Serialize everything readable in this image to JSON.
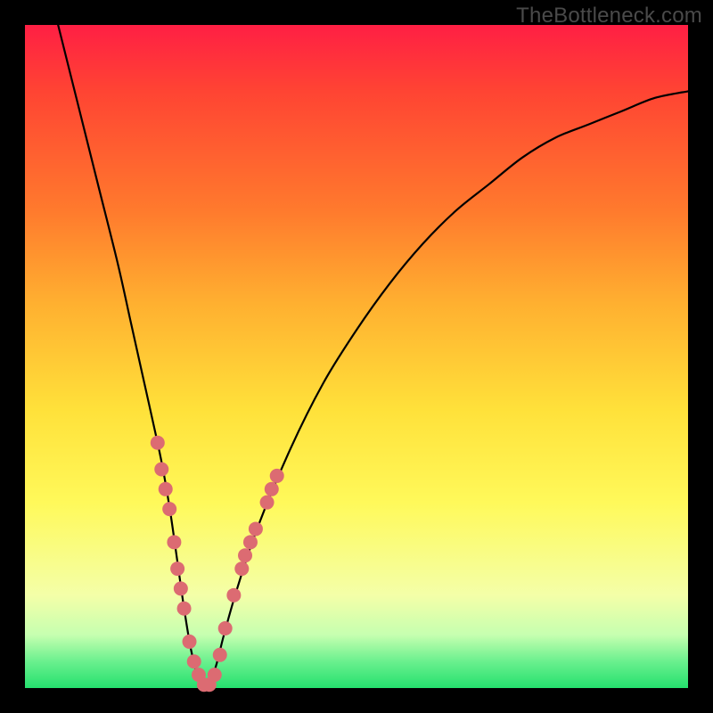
{
  "watermark": "TheBottleneck.com",
  "colors": {
    "frame": "#000000",
    "gradient_top": "#ff1f44",
    "gradient_mid1": "#ff8a2a",
    "gradient_mid2": "#ffe93a",
    "gradient_low": "#f7ffb0",
    "gradient_bottom": "#25e06e",
    "curve": "#000000",
    "marker": "#dc6b72"
  },
  "gradient_css": "linear-gradient(to bottom, #ff1f44 0%, #ff4433 10%, #ff7a2d 28%, #ffb030 42%, #ffe13a 58%, #fff95a 72%, #f4ffa8 86%, #c6ffb0 92%, #6af08e 96%, #25e06e 100%)",
  "chart_data": {
    "type": "line",
    "title": "",
    "xlabel": "",
    "ylabel": "",
    "xlim": [
      0,
      100
    ],
    "ylim": [
      0,
      100
    ],
    "grid": false,
    "legend": false,
    "series": [
      {
        "name": "bottleneck-curve",
        "x": [
          5,
          8,
          11,
          14,
          16,
          18,
          20,
          21,
          22,
          23,
          24,
          25,
          26,
          27,
          28,
          29,
          30,
          32,
          35,
          40,
          45,
          50,
          55,
          60,
          65,
          70,
          75,
          80,
          85,
          90,
          95,
          100
        ],
        "y": [
          100,
          88,
          76,
          64,
          55,
          46,
          37,
          32,
          26,
          19,
          12,
          6,
          2,
          0,
          1,
          4,
          8,
          15,
          24,
          36,
          46,
          54,
          61,
          67,
          72,
          76,
          80,
          83,
          85,
          87,
          89,
          90
        ]
      }
    ],
    "markers": [
      {
        "x": 20.0,
        "y": 37
      },
      {
        "x": 20.6,
        "y": 33
      },
      {
        "x": 21.2,
        "y": 30
      },
      {
        "x": 21.8,
        "y": 27
      },
      {
        "x": 22.5,
        "y": 22
      },
      {
        "x": 23.0,
        "y": 18
      },
      {
        "x": 23.5,
        "y": 15
      },
      {
        "x": 24.0,
        "y": 12
      },
      {
        "x": 24.8,
        "y": 7
      },
      {
        "x": 25.5,
        "y": 4
      },
      {
        "x": 26.2,
        "y": 2
      },
      {
        "x": 27.0,
        "y": 0.5
      },
      {
        "x": 27.8,
        "y": 0.5
      },
      {
        "x": 28.6,
        "y": 2
      },
      {
        "x": 29.4,
        "y": 5
      },
      {
        "x": 30.2,
        "y": 9
      },
      {
        "x": 31.5,
        "y": 14
      },
      {
        "x": 32.7,
        "y": 18
      },
      {
        "x": 33.2,
        "y": 20
      },
      {
        "x": 34.0,
        "y": 22
      },
      {
        "x": 34.8,
        "y": 24
      },
      {
        "x": 36.5,
        "y": 28
      },
      {
        "x": 37.2,
        "y": 30
      },
      {
        "x": 38.0,
        "y": 32
      }
    ]
  }
}
